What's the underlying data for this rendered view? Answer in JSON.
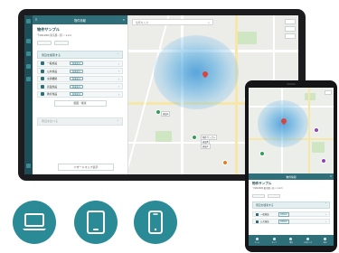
{
  "tablet": {
    "header_title": "物件情報",
    "property_title": "物件サンプル",
    "address_line": "〒000-0000 東京都○○区○○ 1-2-3",
    "extra_line": "",
    "section_label": "周辺を検索する",
    "rows": [
      {
        "label": "一般施設",
        "tag": "結果表示"
      },
      {
        "label": "公共施設",
        "tag": "結果表示"
      },
      {
        "label": "交通機関",
        "tag": "結果表示"
      },
      {
        "label": "商業施設",
        "tag": "結果表示"
      },
      {
        "label": "教育施設",
        "tag": "結果表示"
      }
    ],
    "select_button": "範囲・検索",
    "collapsed_section": "周辺を比べる",
    "hazard_button": "ハザードマップ表示",
    "rail_labels": [
      "",
      "",
      "",
      ""
    ],
    "search_placeholder": "住所を入力",
    "map_tags": [
      "施設A",
      "物件サンプル",
      "施設B",
      "施設C"
    ]
  },
  "phone": {
    "header_title": "物件情報",
    "property_title": "物件サンプル",
    "address_line": "〒000-0000 東京都○○区○○ 1-2-3",
    "section_label": "周辺を検索する",
    "rows": [
      {
        "label": "一般施設",
        "tag": "結果表示"
      },
      {
        "label": "公共施設",
        "tag": "結果表示"
      }
    ],
    "tabs": [
      "ホーム",
      "マップ",
      "物件",
      "お気に入り",
      "設定"
    ]
  },
  "colors": {
    "teal_dark": "#1f4d55",
    "teal": "#2f6f7a",
    "icon_circle": "#2a8b97",
    "heat": "#4aa8df",
    "pin_red": "#d9443c",
    "pin_purple": "#8e44ad"
  },
  "devices": [
    "laptop-icon",
    "tablet-icon",
    "smartphone-icon"
  ]
}
